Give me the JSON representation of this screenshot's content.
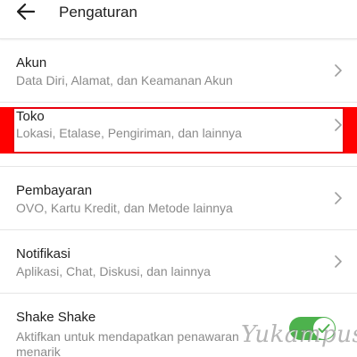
{
  "appbar": {
    "title": "Pengaturan"
  },
  "items": [
    {
      "title": "Akun",
      "subtitle": "Data Diri, Alamat, dan Keamanan Akun"
    },
    {
      "title": "Toko",
      "subtitle": "Lokasi, Etalase, Pengiriman, dan lainnya"
    },
    {
      "title": "Pembayaran",
      "subtitle": "OVO, Kartu Kredit, dan Metode lainnya"
    },
    {
      "title": "Notifikasi",
      "subtitle": "Aplikasi, Chat, Diskusi, dan lainnya"
    }
  ],
  "shake": {
    "title": "Shake Shake",
    "subtitle": "Aktifkan untuk mendapatkan penawaran menarik",
    "enabled": true
  },
  "watermark": "Yukampus.com",
  "colors": {
    "highlight": "#e8000d",
    "toggle_on": "#4db24d"
  }
}
